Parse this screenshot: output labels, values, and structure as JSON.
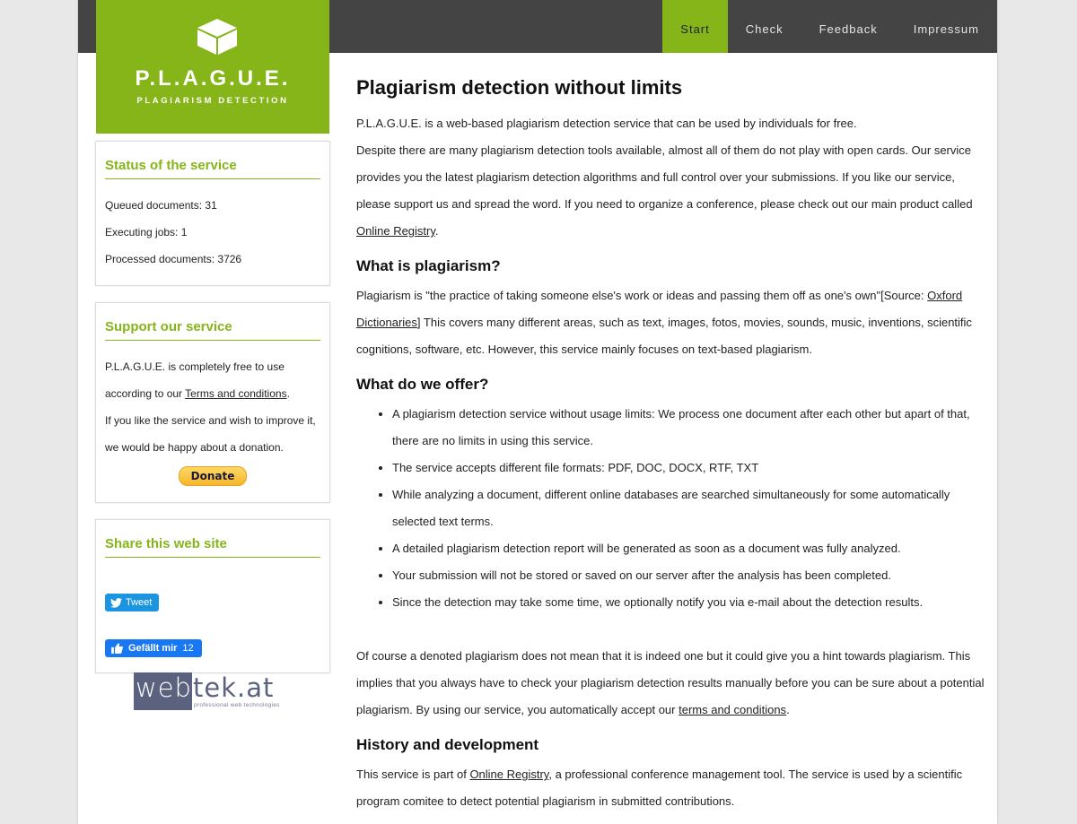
{
  "brand": {
    "title": "P.L.A.G.U.E.",
    "subtitle": "PLAGIARISM DETECTION",
    "accent_color": "#86b519",
    "topbar_color": "#444444"
  },
  "nav": [
    {
      "label": "Start",
      "active": true
    },
    {
      "label": "Check",
      "active": false
    },
    {
      "label": "Feedback",
      "active": false
    },
    {
      "label": "Impressum",
      "active": false
    }
  ],
  "sidebar": {
    "status": {
      "title": "Status of the service",
      "queued": "Queued documents: 31",
      "executing": "Executing jobs: 1",
      "processed": "Processed documents: 3726"
    },
    "support": {
      "title": "Support our service",
      "text1_pre": "P.L.A.G.U.E. is completely free to use according to our ",
      "text1_link": "Terms and conditions",
      "text1_post": ".",
      "text2": "If you like the service and wish to improve it, we would be happy about a donation.",
      "donate_label": "Donate"
    },
    "share": {
      "title": "Share this web site",
      "tweet_label": "Tweet",
      "like_label": "Gefällt mir",
      "like_count": "12"
    },
    "sponsor": {
      "name_left": "web",
      "name_right": "tek.at",
      "tagline": "professional web technologies"
    }
  },
  "main": {
    "heading": "Plagiarism detection without limits",
    "intro1": "P.L.A.G.U.E. is a web-based plagiarism detection service that can be used by individuals for free.",
    "intro2": "Despite there are many plagiarism detection tools available, almost all of them do not play with open cards. Our service provides you the latest plagiarism detection algorithms and full control over your submissions. If you like our service, please support us and spread the word. If you need to organize a conference, please check out our main product called ",
    "intro2_link": "Online Registry",
    "intro2_post": ".",
    "what_heading": "What is plagiarism?",
    "what_pre": "Plagiarism is \"the practice of taking someone else's work or ideas and passing them off as one's own\"[Source: ",
    "what_link": "Oxford Dictionaries",
    "what_post": "] This covers many different areas, such as text, images, fotos, movies, sounds, music, inventions, scientific cognitions, software, etc. However, this service mainly focuses on text-based plagiarism.",
    "offer_heading": "What do we offer?",
    "offer_items": [
      "A plagiarism detection service without usage limits: We process one document after each other but apart of that, there are no limits in using this service.",
      "The service accepts different file formats: PDF, DOC, DOCX, RTF, TXT",
      "While analyzing a document, different online databases are searched simultaneously for some automatically selected text terms.",
      "A detailed plagiarism detection report will be generated as soon as a document was fully analyzed.",
      "Your submission will not be stored or saved on our server after the analysis has been completed.",
      "Since the detection may take some time, we optionally notify you via e-mail about the detection results."
    ],
    "disclaimer_pre": "Of course a denoted plagiarism does not mean that it is indeed one but it could give you a hint towards plagiarism. This implies that you always have to check your plagiarism detection results manually before you can be sure about a potential plagiarism. By using our service, you automatically accept our ",
    "disclaimer_link": "terms and conditions",
    "disclaimer_post": ".",
    "history_heading": "History and development",
    "history_pre": "This service is part of ",
    "history_link": "Online Registry",
    "history_post": ", a professional conference management tool. The service is used by a scientific program comitee to detect potential plagiarism in submitted contributions."
  }
}
